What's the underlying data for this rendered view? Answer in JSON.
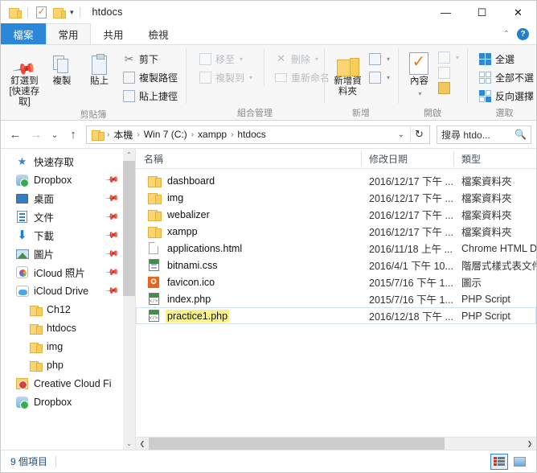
{
  "window": {
    "title": "htdocs",
    "quick_access": [
      "folder-icon",
      "properties-icon",
      "new-folder-icon",
      "customize-dropdown"
    ],
    "minimize": "—",
    "maximize": "☐",
    "close": "✕"
  },
  "ribbon": {
    "tabs": [
      {
        "label": "檔案",
        "type": "file"
      },
      {
        "label": "常用",
        "type": "active"
      },
      {
        "label": "共用",
        "type": "normal"
      },
      {
        "label": "檢視",
        "type": "normal"
      }
    ],
    "collapse_icon": "chevron-up-icon",
    "help_icon": "?",
    "groups": [
      {
        "label": "剪貼簿",
        "big_buttons": [
          {
            "label": "釘選到 [快速存取]",
            "icon": "pin-icon"
          },
          {
            "label": "複製",
            "icon": "copy-icon"
          },
          {
            "label": "貼上",
            "icon": "paste-icon"
          }
        ],
        "small_buttons": [
          {
            "label": "剪下",
            "icon": "scissors-icon",
            "disabled": false
          },
          {
            "label": "複製路徑",
            "icon": "copy-path-icon",
            "disabled": false
          },
          {
            "label": "貼上捷徑",
            "icon": "paste-shortcut-icon",
            "disabled": false
          }
        ]
      },
      {
        "label": "組合管理",
        "small_buttons": [
          {
            "label": "移至",
            "icon": "move-to-icon",
            "disabled": true,
            "dropdown": true
          },
          {
            "label": "複製到",
            "icon": "copy-to-icon",
            "disabled": true,
            "dropdown": true
          },
          {
            "label": "刪除",
            "icon": "delete-icon",
            "disabled": true,
            "dropdown": true
          },
          {
            "label": "重新命名",
            "icon": "rename-icon",
            "disabled": true
          }
        ]
      },
      {
        "label": "新增",
        "big_buttons": [
          {
            "label": "新增資料夾",
            "icon": "new-folder-icon"
          }
        ],
        "small_buttons": [
          {
            "label": "",
            "icon": "new-item-icon",
            "dropdown": true
          },
          {
            "label": "",
            "icon": "easy-access-icon",
            "dropdown": true
          }
        ]
      },
      {
        "label": "開啟",
        "big_buttons": [
          {
            "label": "內容",
            "icon": "properties-icon",
            "dropdown": true
          }
        ],
        "small_buttons": [
          {
            "label": "",
            "icon": "open-with-icon",
            "dropdown": true
          },
          {
            "label": "",
            "icon": "edit-icon"
          },
          {
            "label": "",
            "icon": "history-icon"
          }
        ]
      },
      {
        "label": "選取",
        "small_buttons": [
          {
            "label": "全選",
            "icon": "select-all-icon"
          },
          {
            "label": "全部不選",
            "icon": "select-none-icon"
          },
          {
            "label": "反向選擇",
            "icon": "invert-selection-icon"
          }
        ]
      }
    ]
  },
  "address": {
    "back_icon": "arrow-left-icon",
    "forward_icon": "arrow-right-icon",
    "recent_icon": "chevron-down-icon",
    "up_icon": "arrow-up-icon",
    "breadcrumbs": [
      "本機",
      "Win 7 (C:)",
      "xampp",
      "htdocs"
    ],
    "separator": "›",
    "dropdown_icon": "chevron-down-icon",
    "refresh_icon": "↻",
    "search_placeholder": "搜尋 htdo...",
    "search_icon": "search-icon"
  },
  "sidebar": {
    "items": [
      {
        "label": "快速存取",
        "icon": "star-icon",
        "pinned": false,
        "level": 1
      },
      {
        "label": "Dropbox",
        "icon": "dropbox-icon",
        "pinned": true,
        "level": 1
      },
      {
        "label": "桌面",
        "icon": "desktop-icon",
        "pinned": true,
        "level": 1
      },
      {
        "label": "文件",
        "icon": "documents-icon",
        "pinned": true,
        "level": 1
      },
      {
        "label": "下載",
        "icon": "downloads-icon",
        "pinned": true,
        "level": 1
      },
      {
        "label": "圖片",
        "icon": "pictures-icon",
        "pinned": true,
        "level": 1
      },
      {
        "label": "iCloud 照片",
        "icon": "icloud-photos-icon",
        "pinned": true,
        "level": 1
      },
      {
        "label": "iCloud Drive",
        "icon": "icloud-drive-icon",
        "pinned": true,
        "level": 1
      },
      {
        "label": "Ch12",
        "icon": "folder-icon",
        "pinned": false,
        "level": 2
      },
      {
        "label": "htdocs",
        "icon": "folder-icon",
        "pinned": false,
        "level": 2
      },
      {
        "label": "img",
        "icon": "folder-icon",
        "pinned": false,
        "level": 2
      },
      {
        "label": "php",
        "icon": "folder-icon",
        "pinned": false,
        "level": 2
      },
      {
        "label": "Creative Cloud Fi",
        "icon": "creative-cloud-icon",
        "pinned": false,
        "level": 1
      },
      {
        "label": "Dropbox",
        "icon": "dropbox-icon",
        "pinned": false,
        "level": 1
      }
    ],
    "scroll_up_icon": "chevron-up-icon",
    "scroll_down_icon": "chevron-down-icon"
  },
  "filelist": {
    "columns": [
      {
        "key": "name",
        "label": "名稱"
      },
      {
        "key": "date",
        "label": "修改日期"
      },
      {
        "key": "type",
        "label": "類型"
      }
    ],
    "sort_indicator": "^",
    "rows": [
      {
        "name": "dashboard",
        "date": "2016/12/17 下午 ...",
        "type": "檔案資料夾",
        "icon": "folder-icon",
        "selected": false
      },
      {
        "name": "img",
        "date": "2016/12/17 下午 ...",
        "type": "檔案資料夾",
        "icon": "folder-icon",
        "selected": false
      },
      {
        "name": "webalizer",
        "date": "2016/12/17 下午 ...",
        "type": "檔案資料夾",
        "icon": "folder-icon",
        "selected": false
      },
      {
        "name": "xampp",
        "date": "2016/12/17 下午 ...",
        "type": "檔案資料夾",
        "icon": "folder-icon",
        "selected": false
      },
      {
        "name": "applications.html",
        "date": "2016/11/18 上午 ...",
        "type": "Chrome HTML D...",
        "icon": "html-file-icon",
        "selected": false
      },
      {
        "name": "bitnami.css",
        "date": "2016/4/1 下午 10...",
        "type": "階層式樣式表文件",
        "icon": "css-file-icon",
        "selected": false
      },
      {
        "name": "favicon.ico",
        "date": "2015/7/16 下午 1...",
        "type": "圖示",
        "icon": "ico-file-icon",
        "selected": false
      },
      {
        "name": "index.php",
        "date": "2015/7/16 下午 1...",
        "type": "PHP Script",
        "icon": "php-file-icon",
        "selected": false
      },
      {
        "name": "practice1.php",
        "date": "2016/12/18 下午 ...",
        "type": "PHP Script",
        "icon": "php-file-icon",
        "selected": true
      }
    ],
    "hscroll_left_icon": "chevron-left-icon",
    "hscroll_right_icon": "chevron-right-icon"
  },
  "statusbar": {
    "item_count": "9 個項目",
    "view_details_icon": "details-view-icon",
    "view_thumbnails_icon": "thumbnail-view-icon"
  }
}
